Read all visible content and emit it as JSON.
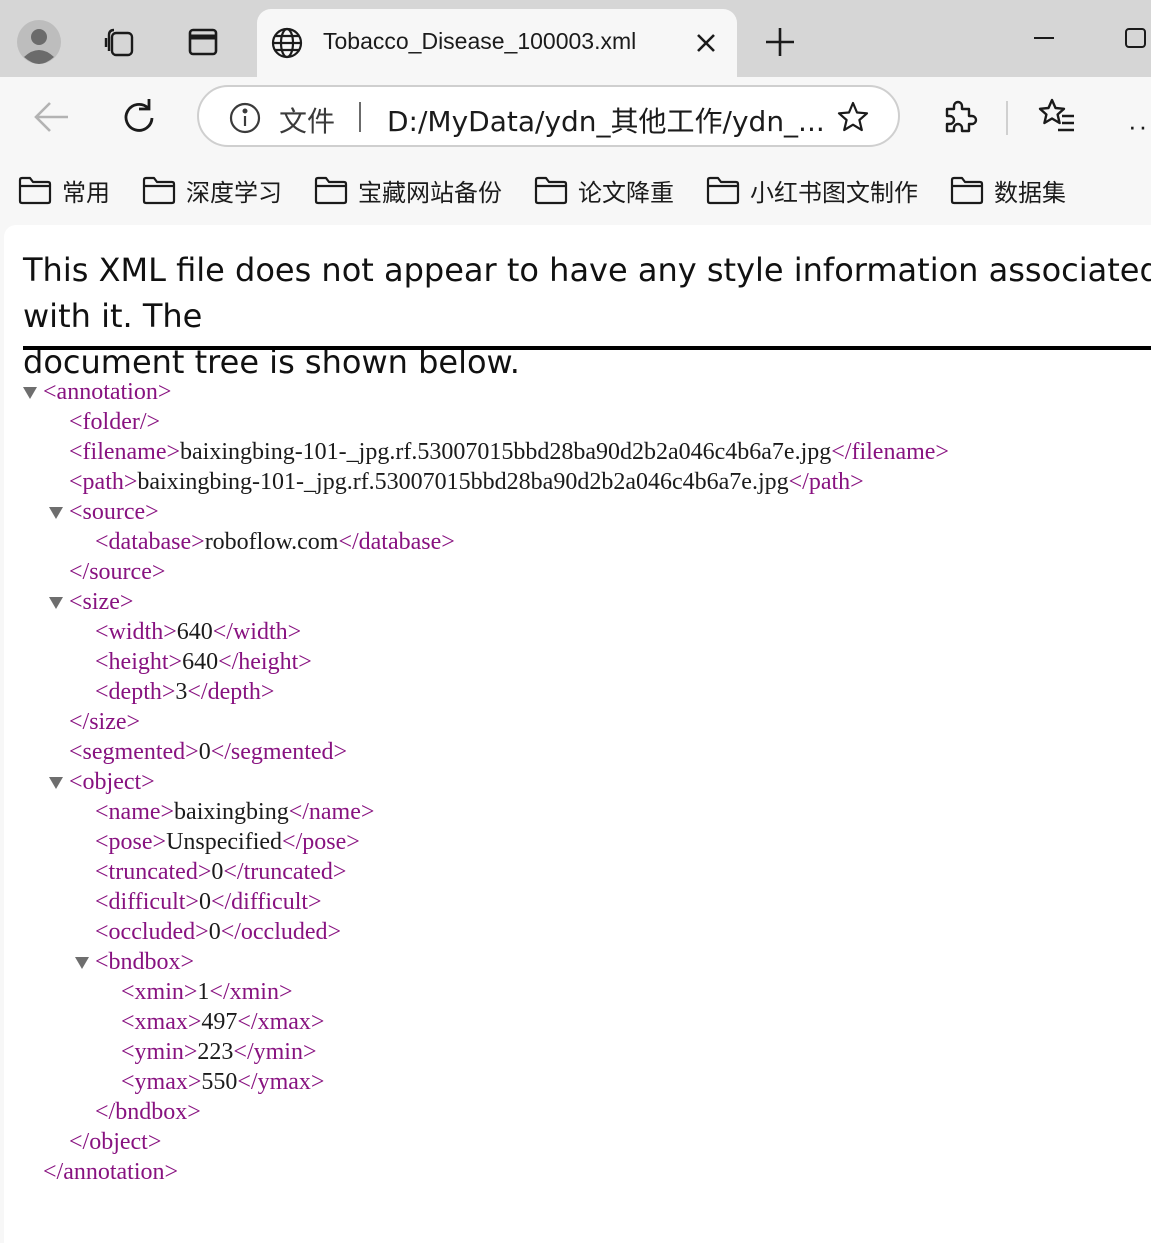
{
  "tab": {
    "title": "Tobacco_Disease_100003.xml"
  },
  "address_bar": {
    "scheme_label": "文件",
    "url": "D:/MyData/ydn_其他工作/ydn_..."
  },
  "toolbar": {
    "more_label": "··"
  },
  "bookmarks": [
    {
      "label": "常用"
    },
    {
      "label": "深度学习"
    },
    {
      "label": "宝藏网站备份"
    },
    {
      "label": "论文降重"
    },
    {
      "label": "小红书图文制作"
    },
    {
      "label": "数据集"
    }
  ],
  "xml_viewer": {
    "info_line1": "This XML file does not appear to have any style information associated with it. The",
    "info_line2": "document tree is shown below."
  },
  "xml": {
    "filename": "baixingbing-101-_jpg.rf.53007015bbd28ba90d2b2a046c4b6a7e.jpg",
    "path": "baixingbing-101-_jpg.rf.53007015bbd28ba90d2b2a046c4b6a7e.jpg",
    "database": "roboflow.com",
    "width": "640",
    "height": "640",
    "depth": "3",
    "segmented": "0",
    "name": "baixingbing",
    "pose": "Unspecified",
    "truncated": "0",
    "difficult": "0",
    "occluded": "0",
    "xmin": "1",
    "xmax": "497",
    "ymin": "223",
    "ymax": "550"
  },
  "xml_tags": {
    "annotation_open": "<annotation>",
    "annotation_close": "</annotation>",
    "folder": "<folder/>",
    "filename_open": "<filename>",
    "filename_close": "</filename>",
    "path_open": "<path>",
    "path_close": "</path>",
    "source_open": "<source>",
    "source_close": "</source>",
    "database_open": "<database>",
    "database_close": "</database>",
    "size_open": "<size>",
    "size_close": "</size>",
    "width_open": "<width>",
    "width_close": "</width>",
    "height_open": "<height>",
    "height_close": "</height>",
    "depth_open": "<depth>",
    "depth_close": "</depth>",
    "segmented_open": "<segmented>",
    "segmented_close": "</segmented>",
    "object_open": "<object>",
    "object_close": "</object>",
    "name_open": "<name>",
    "name_close": "</name>",
    "pose_open": "<pose>",
    "pose_close": "</pose>",
    "truncated_open": "<truncated>",
    "truncated_close": "</truncated>",
    "difficult_open": "<difficult>",
    "difficult_close": "</difficult>",
    "occluded_open": "<occluded>",
    "occluded_close": "</occluded>",
    "bndbox_open": "<bndbox>",
    "bndbox_close": "</bndbox>",
    "xmin_open": "<xmin>",
    "xmin_close": "</xmin>",
    "xmax_open": "<xmax>",
    "xmax_close": "</xmax>",
    "ymin_open": "<ymin>",
    "ymin_close": "</ymin>",
    "ymax_open": "<ymax>",
    "ymax_close": "</ymax>"
  },
  "colors": {
    "tag": "#881280",
    "text": "#1b1b1b",
    "tabstrip": "#d6d6d6",
    "toolbar": "#f7f7f7"
  }
}
